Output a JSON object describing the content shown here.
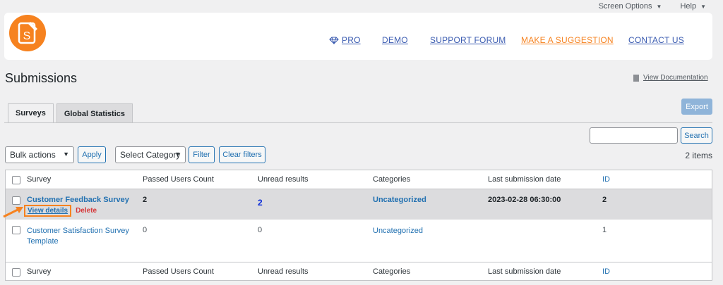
{
  "screen_meta": {
    "screen_options": "Screen Options",
    "help": "Help"
  },
  "nav": {
    "pro": "PRO",
    "demo": "DEMO",
    "support": "SUPPORT FORUM",
    "suggestion": "MAKE A SUGGESTION",
    "contact": "CONTACT US"
  },
  "colors": {
    "accent": "#f6821f",
    "link": "#2271b1"
  },
  "page": {
    "title": "Submissions",
    "view_documentation": "View Documentation"
  },
  "tabs": [
    {
      "label": "Surveys",
      "active": true
    },
    {
      "label": "Global Statistics",
      "active": false
    }
  ],
  "toolbar": {
    "export": "Export",
    "search": "Search",
    "search_value": "",
    "bulk_actions": "Bulk actions",
    "apply": "Apply",
    "select_category": "Select Category",
    "filter": "Filter",
    "clear_filters": "Clear filters",
    "items_count": "2 items"
  },
  "table": {
    "columns": [
      "Survey",
      "Passed Users Count",
      "Unread results",
      "Categories",
      "Last submission date",
      "ID"
    ],
    "rows": [
      {
        "survey": "Customer Feedback Survey",
        "passed": "2",
        "unread": "2",
        "category": "Uncategorized",
        "date": "2023-02-28 06:30:00",
        "id": "2",
        "view_details": "View details",
        "delete": "Delete"
      },
      {
        "survey": "Customer Satisfaction Survey Template",
        "passed": "0",
        "unread": "0",
        "category": "Uncategorized",
        "date": "",
        "id": "1"
      }
    ]
  }
}
